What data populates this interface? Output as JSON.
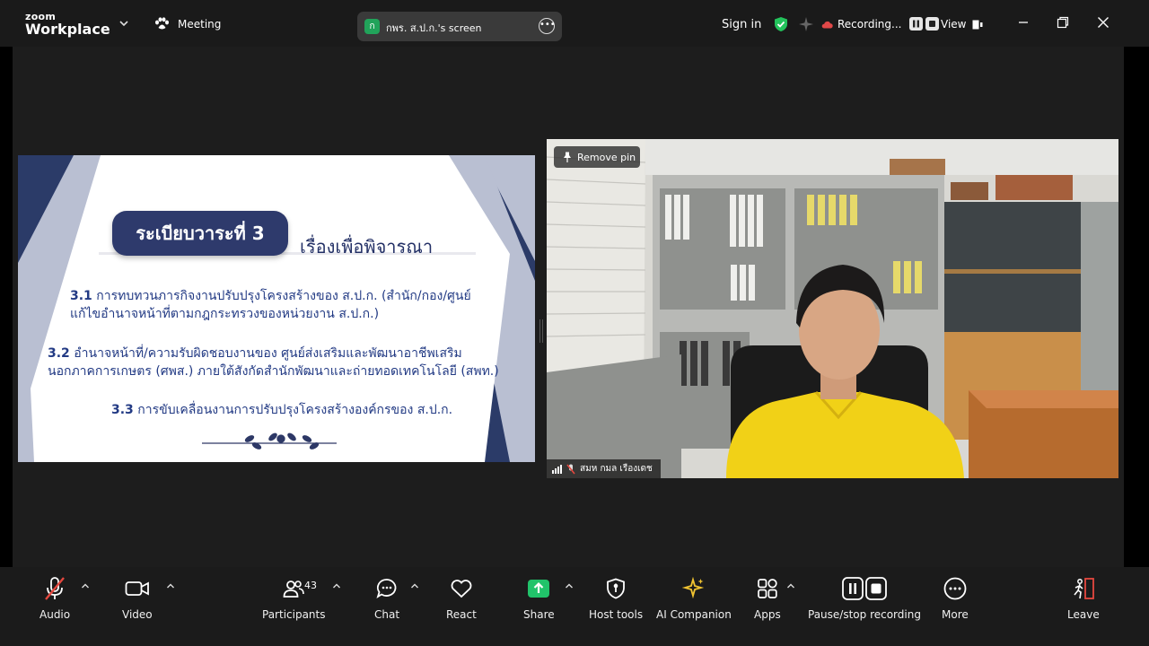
{
  "app": {
    "brand_top": "zoom",
    "brand_bottom": "Workplace",
    "meeting_label": "Meeting"
  },
  "share_pill": {
    "avatar_letter": "ก",
    "label": "กพร. ส.ป.ก.'s screen"
  },
  "header": {
    "sign_in": "Sign in",
    "recording": "Recording...",
    "view": "View"
  },
  "slide": {
    "title": "ระเบียบวาระที่ 3",
    "subtitle": "เรื่องเพื่อพิจารณา",
    "items": [
      {
        "num": "3.1",
        "line1": "การทบทวนภารกิจงานปรับปรุงโครงสร้างของ ส.ป.ก. (สำนัก/กอง/ศูนย์",
        "line2": "แก้ไขอำนาจหน้าที่ตามกฎกระทรวงของหน่วยงาน ส.ป.ก.)"
      },
      {
        "num": "3.2",
        "line1": "อำนาจหน้าที่/ความรับผิดชอบงานของ ศูนย์ส่งเสริมและพัฒนาอาชีพเสริม",
        "line2": "นอกภาคการเกษตร (ศพส.) ภายใต้สังกัดสำนักพัฒนาและถ่ายทอดเทคโนโลยี (สพท.)"
      },
      {
        "num": "3.3",
        "line1": "การขับเคลื่อนงานการปรับปรุงโครงสร้างองค์กรของ ส.ป.ก."
      }
    ]
  },
  "video": {
    "remove_pin": "Remove pin",
    "participant_name": "สมห กมล เรืองเดช"
  },
  "toolbar": {
    "audio": "Audio",
    "video": "Video",
    "participants": "Participants",
    "participants_count": "43",
    "chat": "Chat",
    "react": "React",
    "share": "Share",
    "host_tools": "Host tools",
    "ai_companion": "AI Companion",
    "apps": "Apps",
    "pause_stop": "Pause/stop recording",
    "more": "More",
    "leave": "Leave"
  },
  "colors": {
    "share_green": "#21c36a",
    "leave_red": "#e5483f",
    "shield_green": "#23c35c",
    "slide_navy": "#2b3b68"
  }
}
